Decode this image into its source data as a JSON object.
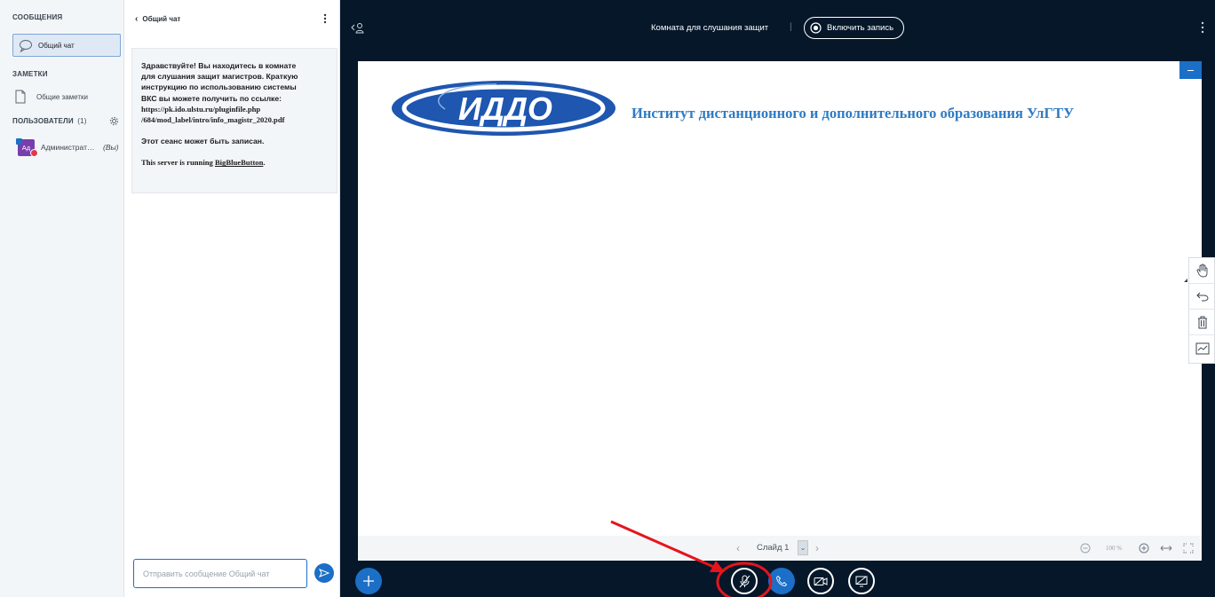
{
  "sidebar": {
    "messages_title": "СООБЩЕНИЯ",
    "public_chat": "Общий чат",
    "notes_title": "ЗАМЕТКИ",
    "shared_notes": "Общие заметки",
    "users_title": "ПОЛЬЗОВАТЕЛИ",
    "users_count": "(1)",
    "user": {
      "initials": "Ад",
      "name": "Администрат…",
      "you": "(Вы)"
    }
  },
  "chat": {
    "back_label": "Общий чат",
    "welcome": {
      "line1": "Здравствуйте! Вы находитесь в комнате",
      "line2": "для слушания защит магистров. Краткую",
      "line3": "инструкцию по использованию системы",
      "line4": "ВКС вы можете получить по ссылке:",
      "line5": "https://pk.ido.ulstu.ru/pluginfile.php",
      "line6": "/684/mod_label/intro/info_magistr_2020.pdf",
      "recording_notice": "Этот сеанс может быть записан.",
      "server_prefix": "This server is running ",
      "server_link": "BigBlueButton",
      "server_suffix": "."
    },
    "input_placeholder": "Отправить сообщение Общий чат"
  },
  "topbar": {
    "room_title": "Комната для слушания защит",
    "separator": "|",
    "record_label": "Включить запись"
  },
  "presentation": {
    "logo_text": "ИДДО",
    "institute": "Институт дистанционного и дополнительного образования УлГТУ",
    "slide_label": "Слайд 1",
    "zoom": "100 %"
  },
  "colors": {
    "accent": "#1b6fc7",
    "dark_bg": "#06172a",
    "logo_blue": "#1e56b0",
    "institute_text": "#2e7bc4",
    "annotation_red": "#e5141b"
  }
}
